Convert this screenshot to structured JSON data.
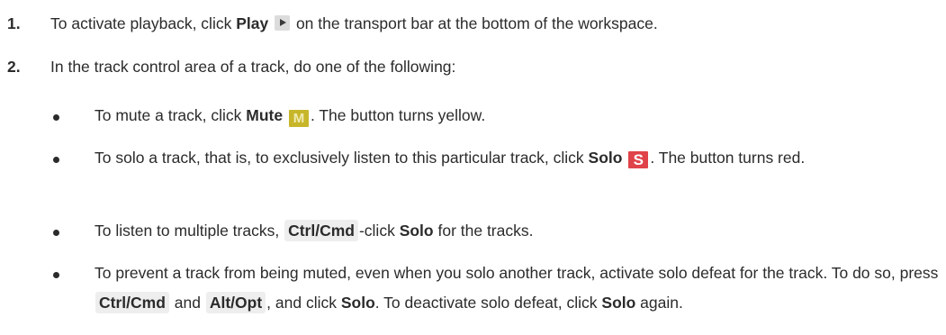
{
  "steps": [
    {
      "number": "1.",
      "before": "To activate playback, click ",
      "bold": "Play",
      "icon": "play-icon",
      "after": " on the transport bar at the bottom of the workspace."
    },
    {
      "number": "2.",
      "text": "In the track control area of a track, do one of the following:"
    }
  ],
  "bullets": {
    "mute": {
      "before": "To mute a track, click ",
      "bold": "Mute",
      "icon_letter": "M",
      "after": ". The button turns yellow."
    },
    "solo": {
      "before": "To solo a track, that is, to exclusively listen to this particular track, click ",
      "bold": "Solo",
      "icon_letter": "S",
      "after": ". The button turns red."
    },
    "multi": {
      "before": "To listen to multiple tracks, ",
      "key": "Ctrl/Cmd",
      "middle": "-click ",
      "bold": "Solo",
      "after": " for the tracks."
    },
    "defeat": {
      "part1": "To prevent a track from being muted, even when you solo another track, activate solo defeat for the track. To do so, press ",
      "key1": "Ctrl/Cmd",
      "and": " and ",
      "key2": "Alt/Opt",
      "part2": ", and click ",
      "bold1": "Solo",
      "part3": ". To deactivate solo defeat, click ",
      "bold2": "Solo",
      "part4": " again."
    }
  },
  "colors": {
    "mute_button": "#c7b62a",
    "solo_button": "#e0434a",
    "key_background": "#eeeeee",
    "text": "#2b2b2b"
  }
}
